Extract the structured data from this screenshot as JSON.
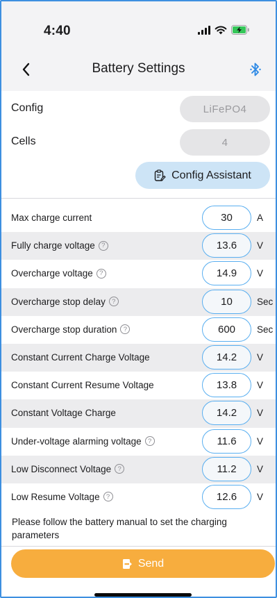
{
  "status_bar": {
    "time": "4:40"
  },
  "nav": {
    "title": "Battery Settings"
  },
  "config": {
    "label": "Config",
    "value": "LiFePO4"
  },
  "cells": {
    "label": "Cells",
    "value": "4"
  },
  "assistant_button": {
    "label": "Config Assistant"
  },
  "params": [
    {
      "label": "Max charge current",
      "value": "30",
      "unit": "A",
      "help": false
    },
    {
      "label": "Fully charge voltage",
      "value": "13.6",
      "unit": "V",
      "help": true
    },
    {
      "label": "Overcharge voltage",
      "value": "14.9",
      "unit": "V",
      "help": true
    },
    {
      "label": "Overcharge stop delay",
      "value": "10",
      "unit": "Sec",
      "help": true
    },
    {
      "label": "Overcharge stop duration",
      "value": "600",
      "unit": "Sec",
      "help": true
    },
    {
      "label": "Constant Current Charge Voltage",
      "value": "14.2",
      "unit": "V",
      "help": false
    },
    {
      "label": "Constant Current Resume Voltage",
      "value": "13.8",
      "unit": "V",
      "help": false
    },
    {
      "label": "Constant Voltage Charge",
      "value": "14.2",
      "unit": "V",
      "help": false
    },
    {
      "label": "Under-voltage alarming voltage",
      "value": "11.6",
      "unit": "V",
      "help": true
    },
    {
      "label": "Low Disconnect Voltage",
      "value": "11.2",
      "unit": "V",
      "help": true
    },
    {
      "label": "Low Resume Voltage",
      "value": "12.6",
      "unit": "V",
      "help": true
    }
  ],
  "help_glyph": "?",
  "note": "Please follow the battery manual to set the charging parameters",
  "send_button": {
    "label": "Send"
  },
  "icons": {
    "back": "chevron-left-icon",
    "bluetooth": "bluetooth-icon",
    "assistant": "clipboard-edit-icon",
    "send": "exit-door-icon"
  },
  "colors": {
    "accent_blue": "#2f8ae5",
    "input_border": "#58aef0",
    "assistant_bg": "#cde4f6",
    "send_bg": "#f7ad3e",
    "battery_charge": "#35c759"
  }
}
